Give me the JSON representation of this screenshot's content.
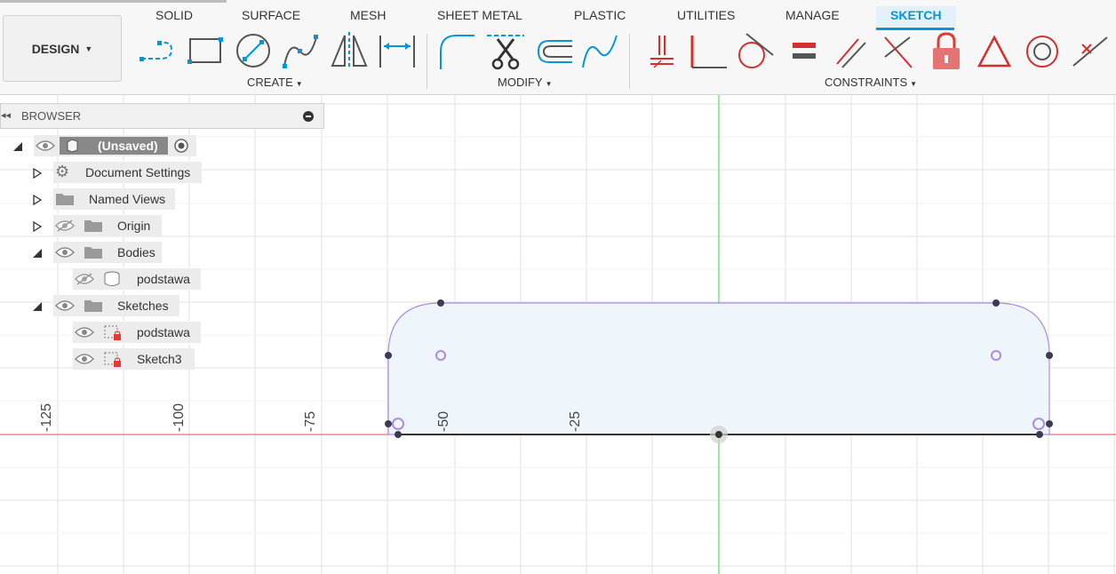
{
  "toolbar": {
    "workspace_label": "DESIGN",
    "tabs": [
      {
        "label": "SOLID"
      },
      {
        "label": "SURFACE"
      },
      {
        "label": "MESH"
      },
      {
        "label": "SHEET METAL"
      },
      {
        "label": "PLASTIC"
      },
      {
        "label": "UTILITIES"
      },
      {
        "label": "MANAGE"
      },
      {
        "label": "SKETCH",
        "active": true
      }
    ],
    "groups": {
      "create": "CREATE",
      "modify": "MODIFY",
      "constraints": "CONSTRAINTS"
    },
    "tools": {
      "create": [
        "line-icon",
        "rectangle-icon",
        "circle-icon",
        "spline-icon",
        "mirror-icon",
        "dimension-icon"
      ],
      "modify": [
        "fillet-icon",
        "trim-icon",
        "offset-icon",
        "curve-icon"
      ],
      "constraints": [
        "fix-icon",
        "coincident-icon",
        "tangent-icon",
        "equal-icon",
        "parallel-icon",
        "perpendicular-icon",
        "lock-icon",
        "triangle-icon",
        "concentric-icon",
        "midpoint-icon"
      ]
    },
    "accent_color": "#0696d7",
    "constraint_color": "#d32f2f"
  },
  "browser": {
    "title": "BROWSER",
    "items": [
      {
        "label": "(Unsaved)"
      },
      {
        "label": "Document Settings"
      },
      {
        "label": "Named Views"
      },
      {
        "label": "Origin"
      },
      {
        "label": "Bodies"
      },
      {
        "label": "podstawa"
      },
      {
        "label": "Sketches"
      },
      {
        "label": "podstawa"
      },
      {
        "label": "Sketch3"
      }
    ]
  },
  "canvas": {
    "axis_labels": [
      "-125",
      "-100",
      "-75",
      "-50",
      "-25"
    ],
    "x_axis_color": "#e05050",
    "y_axis_color": "#3ecf3e",
    "sketch_fill": "#eef6fc",
    "sketch_stroke": "#a98be8"
  }
}
